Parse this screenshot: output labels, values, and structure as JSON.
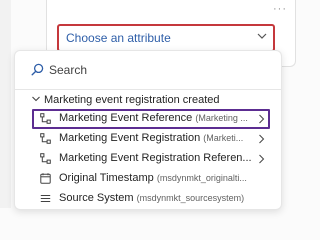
{
  "attribute_picker": {
    "placeholder": "Choose an attribute",
    "more_label": "···"
  },
  "dropdown": {
    "search_placeholder": "Search",
    "group": {
      "label": "Marketing event registration created",
      "items": [
        {
          "label": "Marketing Event Reference",
          "sub": "(Marketing ...",
          "icon": "relationship-icon",
          "has_submenu": true,
          "highlighted": true
        },
        {
          "label": "Marketing Event Registration",
          "sub": "(Marketi...",
          "icon": "relationship-icon",
          "has_submenu": true,
          "highlighted": false
        },
        {
          "label": "Marketing Event Registration Referen...",
          "sub": "",
          "icon": "relationship-icon",
          "has_submenu": true,
          "highlighted": false
        },
        {
          "label": "Original Timestamp",
          "sub": "(msdynmkt_originalti...",
          "icon": "calendar-icon",
          "has_submenu": false,
          "highlighted": false
        },
        {
          "label": "Source System",
          "sub": "(msdynmkt_sourcesystem)",
          "icon": "text-lines-icon",
          "has_submenu": false,
          "highlighted": false
        }
      ]
    }
  },
  "colors": {
    "select_border": "#c5383c",
    "placeholder_text": "#2e5ea8",
    "highlight_border": "#5c2d91"
  }
}
